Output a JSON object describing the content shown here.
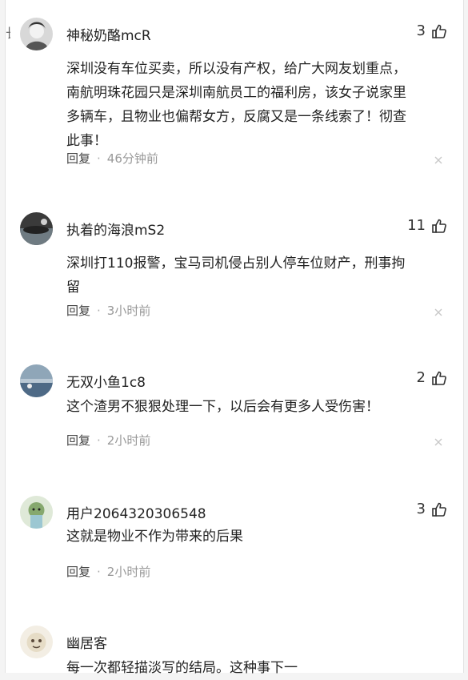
{
  "comments": [
    {
      "username": "神秘奶酪mcR",
      "likes": "3",
      "text": "深圳没有车位买卖，所以没有产权，给广大网友划重点，\n南航明珠花园只是深圳南航员工的福利房，该女子说家里\n多辆车，且物业也偏帮女方，反腐又是一条线索了！彻查\n此事！",
      "reply_label": "回复",
      "time": "46分钟前"
    },
    {
      "username": "执着的海浪mS2",
      "likes": "11",
      "text": "深圳打110报警，宝马司机侵占别人停车位财产，刑事拘\n留",
      "reply_label": "回复",
      "time": "3小时前"
    },
    {
      "username": "无双小鱼1c8",
      "likes": "2",
      "text": "这个渣男不狠狠处理一下，以后会有更多人受伤害！",
      "reply_label": "回复",
      "time": "2小时前"
    },
    {
      "username": "用户2064320306548",
      "likes": "3",
      "text": "这就是物业不作为带来的后果",
      "reply_label": "回复",
      "time": "2小时前"
    },
    {
      "username": "幽居客",
      "text": "每一次都轻描淡写的结局。这种事下一"
    }
  ],
  "meta_separator": "·",
  "colors": {
    "background": "#ffffff",
    "text": "#222222",
    "muted": "#999999"
  }
}
